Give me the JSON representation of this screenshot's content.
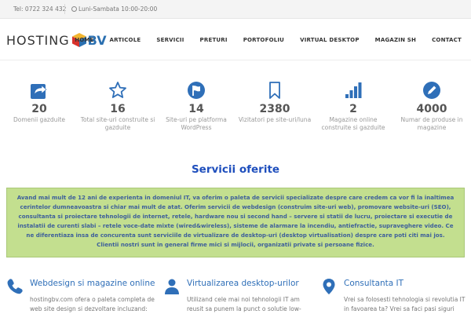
{
  "topbar": {
    "phone": "Tel: 0722 324 432",
    "hours": "Luni-Sambata 10:00-20:00"
  },
  "header": {
    "logo_text_left": "HOSTING",
    "logo_text_right": "BV",
    "nav": [
      "HOME",
      "ARTICOLE",
      "SERVICII",
      "PRETURI",
      "PORTOFOLIU",
      "VIRTUAL DESKTOP",
      "MAGAZIN SH",
      "CONTACT"
    ]
  },
  "stats": [
    {
      "icon": "share-icon",
      "number": "20",
      "label": "Domenii gazduite"
    },
    {
      "icon": "star-icon",
      "number": "16",
      "label": "Total site-uri construite si gazduite"
    },
    {
      "icon": "flag-icon",
      "number": "14",
      "label": "Site-uri pe platforma WordPress"
    },
    {
      "icon": "bookmark-icon",
      "number": "2380",
      "label": "Vizitatori pe site-uri/luna"
    },
    {
      "icon": "signal-icon",
      "number": "2",
      "label": "Magazine online construite si gazduite"
    },
    {
      "icon": "pencil-icon",
      "number": "4000",
      "label": "Numar de produse in magazine"
    }
  ],
  "section": {
    "title": "Servicii oferite",
    "intro": "Avand mai mult de 12 ani de experienta in domeniul IT, va oferim o paleta de servicii specializate despre care credem ca vor fi la inaltimea cerintelor dumneavoastra si chiar mai mult de atat. Oferim servicii de webdesign (construim site-uri web), promovare website-uri (SEO), consultanta si proiectare tehnologii de internet, retele, hardware nou si second hand – servere si statii de lucru, proiectare si executie de instalatii de curenti slabi – retele voce-date mixte (wired&wireless), sisteme de alarmare la incendiu, antiefractie, supraveghere video. Ce ne diferentiaza insa de concurenta sunt serviciile de virtualizare de desktop-uri (desktop virtualisation) despre care poti citi mai jos. Clientii nostri sunt in general firme mici si mijlocii, organizatii private si persoane fizice."
  },
  "services": [
    {
      "icon": "phone-icon",
      "title": "Webdesign si magazine online",
      "text": "hostingbv.com ofera o paleta completa de web site design si dezvoltare incluzand:"
    },
    {
      "icon": "user-icon",
      "title": "Virtualizarea desktop-urilor",
      "text": "Utilizand cele mai noi tehnologii IT am reusit sa punem la punct o solutie low-"
    },
    {
      "icon": "location-icon",
      "title": "Consultanta IT",
      "text": "Vrei sa folosesti tehnologia si revolutia IT in favoarea ta? Vrei sa faci pasi siguri"
    }
  ],
  "colors": {
    "accent_blue": "#2f6fb8",
    "title_blue": "#1f4fbd",
    "green_box": "#c3df8f"
  }
}
